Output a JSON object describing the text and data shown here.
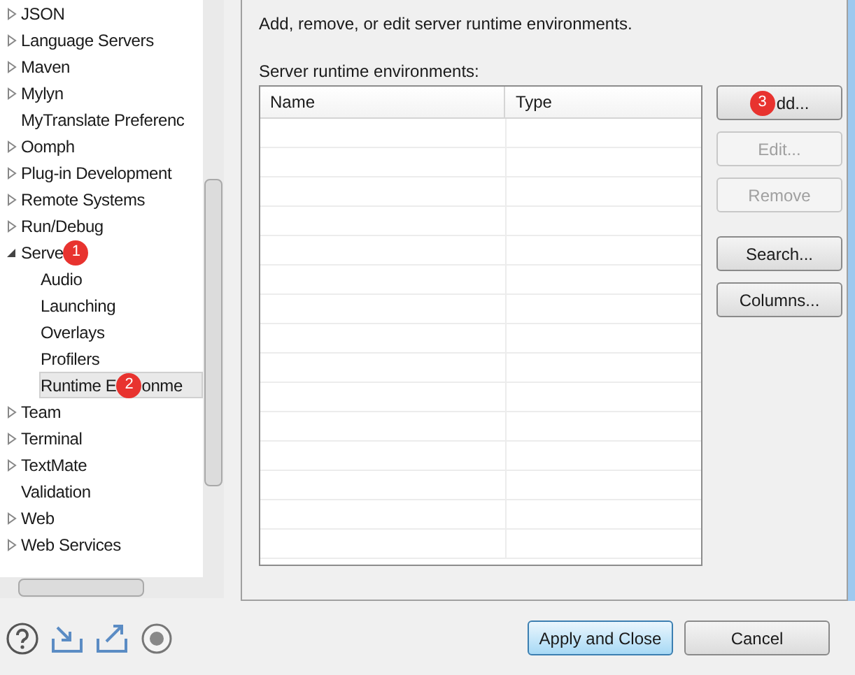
{
  "tree": {
    "items": [
      {
        "label": "JSON",
        "expanded": false,
        "selected": false
      },
      {
        "label": "Language Servers",
        "expanded": false,
        "selected": false
      },
      {
        "label": "Maven",
        "expanded": false,
        "selected": false
      },
      {
        "label": "Mylyn",
        "expanded": false,
        "selected": false
      },
      {
        "label": "MyTranslate Preferenc",
        "selected": false
      },
      {
        "label": "Oomph",
        "expanded": false,
        "selected": false
      },
      {
        "label": "Plug-in Development",
        "expanded": false,
        "selected": false
      },
      {
        "label": "Remote Systems",
        "expanded": false,
        "selected": false
      },
      {
        "label": "Run/Debug",
        "expanded": false,
        "selected": false
      },
      {
        "label": "Serve",
        "marker": "1",
        "expanded": true,
        "selected": false,
        "children": [
          {
            "label": "Audio",
            "selected": false
          },
          {
            "label": "Launching",
            "selected": false
          },
          {
            "label": "Overlays",
            "selected": false
          },
          {
            "label": "Profilers",
            "selected": false
          },
          {
            "label": "Runtime E",
            "marker": "2",
            "label_after_marker": "onme",
            "selected": true
          }
        ]
      },
      {
        "label": "Team",
        "expanded": false,
        "selected": false
      },
      {
        "label": "Terminal",
        "expanded": false,
        "selected": false
      },
      {
        "label": "TextMate",
        "expanded": false,
        "selected": false
      },
      {
        "label": "Validation",
        "selected": false
      },
      {
        "label": "Web",
        "expanded": false,
        "selected": false
      },
      {
        "label": "Web Services",
        "expanded": false,
        "selected": false
      }
    ]
  },
  "page": {
    "description": "Add, remove, or edit server runtime environments.",
    "table_label": "Server runtime environments:",
    "table": {
      "columns": [
        "Name",
        "Type"
      ]
    },
    "buttons": [
      {
        "label": "dd...",
        "marker": "3",
        "disabled": false
      },
      {
        "label": "Edit...",
        "disabled": true
      },
      {
        "label": "Remove",
        "disabled": true
      },
      {
        "label": "Search...",
        "disabled": false
      },
      {
        "label": "Columns...",
        "disabled": false
      }
    ]
  },
  "footer": {
    "buttons": [
      {
        "label": "Apply and Close",
        "default": true
      },
      {
        "label": "Cancel",
        "default": false
      }
    ]
  }
}
